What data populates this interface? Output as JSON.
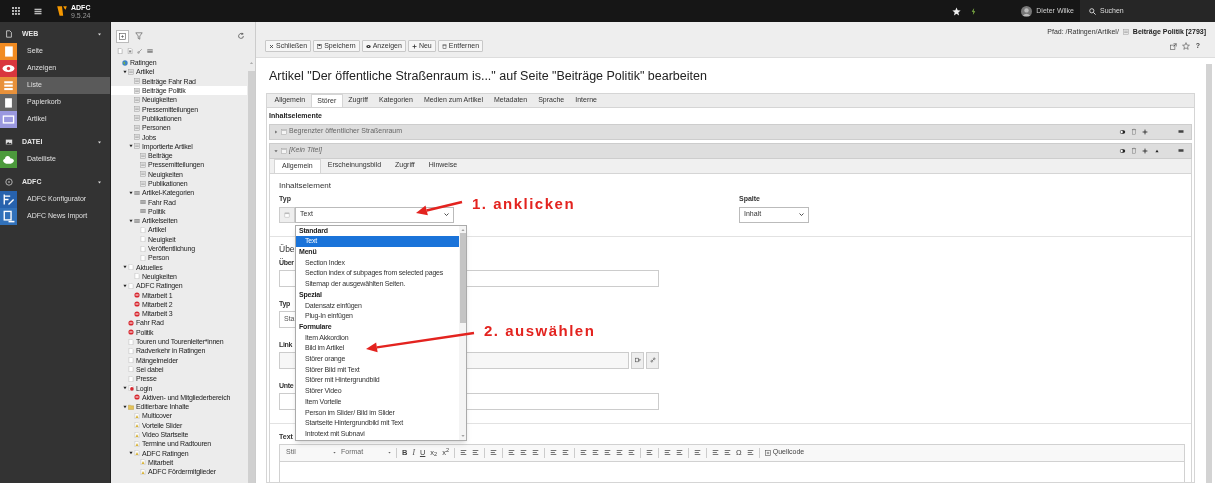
{
  "topbar": {
    "logo_title": "ADFC",
    "logo_version": "9.5.24",
    "user": "Dieter Wilke",
    "search": "Suchen"
  },
  "modules": [
    {
      "label": "WEB",
      "items": [
        {
          "label": "Seite",
          "color": "#f18b21",
          "selected": false
        },
        {
          "label": "Anzeigen",
          "color": "#d9363e",
          "selected": false
        },
        {
          "label": "Liste",
          "color": "#e8913a",
          "selected": true
        },
        {
          "label": "Papierkorb",
          "color": "#666666",
          "selected": false
        },
        {
          "label": "Artikel",
          "color": "#9a98df",
          "selected": false
        }
      ]
    },
    {
      "label": "DATEI",
      "items": [
        {
          "label": "Dateiliste",
          "color": "#4c9a3c",
          "selected": false
        }
      ]
    },
    {
      "label": "ADFC",
      "items": [
        {
          "label": "ADFC Konfigurator",
          "color": "#2762ad",
          "selected": false
        },
        {
          "label": "ADFC News Import",
          "color": "#3171ba",
          "selected": false
        }
      ]
    }
  ],
  "page_tree": {
    "nodes": [
      {
        "label": "Ratingen",
        "kind": "site",
        "selected": false,
        "children": [
          {
            "label": "Artikel",
            "kind": "folder",
            "selected": false,
            "expanded": true,
            "children": [
              {
                "label": "Beiträge Fahr Rad",
                "kind": "folder",
                "selected": false
              },
              {
                "label": "Beiträge Politik",
                "kind": "folder",
                "selected": true
              },
              {
                "label": "Neuigkeiten",
                "kind": "folder",
                "selected": false
              },
              {
                "label": "Pressemitteilungen",
                "kind": "folder",
                "selected": false
              },
              {
                "label": "Publikationen",
                "kind": "folder",
                "selected": false
              },
              {
                "label": "Personen",
                "kind": "folder",
                "selected": false
              },
              {
                "label": "Jobs",
                "kind": "folder",
                "selected": false
              },
              {
                "label": "Importierte Artikel",
                "kind": "folder",
                "selected": false,
                "expanded": true,
                "children": [
                  {
                    "label": "Beiträge",
                    "kind": "folder",
                    "selected": false
                  },
                  {
                    "label": "Pressemitteilungen",
                    "kind": "folder",
                    "selected": false
                  },
                  {
                    "label": "Neuigkeiten",
                    "kind": "folder",
                    "selected": false
                  },
                  {
                    "label": "Publikationen",
                    "kind": "folder",
                    "selected": false
                  }
                ]
              },
              {
                "label": "Artikel-Kategorien",
                "kind": "category",
                "selected": false,
                "expanded": true,
                "children": [
                  {
                    "label": "Fahr Rad",
                    "kind": "category",
                    "selected": false
                  },
                  {
                    "label": "Politik",
                    "kind": "category",
                    "selected": false
                  }
                ]
              },
              {
                "label": "Artikelseiten",
                "kind": "category",
                "selected": false,
                "expanded": true,
                "children": [
                  {
                    "label": "Artikel",
                    "kind": "page",
                    "selected": false
                  },
                  {
                    "label": "Neuigkeit",
                    "kind": "page",
                    "selected": false
                  },
                  {
                    "label": "Veröffentlichung",
                    "kind": "page",
                    "selected": false
                  },
                  {
                    "label": "Person",
                    "kind": "page",
                    "selected": false
                  }
                ]
              }
            ]
          },
          {
            "label": "Aktuelles",
            "kind": "page",
            "selected": false,
            "expanded": true,
            "children": [
              {
                "label": "Neuigkeiten",
                "kind": "page",
                "selected": false
              }
            ]
          },
          {
            "label": "ADFC Ratingen",
            "kind": "page",
            "selected": false,
            "expanded": true,
            "children": [
              {
                "label": "Mitarbeit 1",
                "kind": "restricted",
                "selected": false
              },
              {
                "label": "Mitarbeit 2",
                "kind": "restricted",
                "selected": false
              },
              {
                "label": "Mitarbeit 3",
                "kind": "restricted",
                "selected": false
              }
            ]
          },
          {
            "label": "Fahr Rad",
            "kind": "restricted",
            "selected": false
          },
          {
            "label": "Politik",
            "kind": "restricted",
            "selected": false
          },
          {
            "label": "Touren und Tourenleiter*innen",
            "kind": "page",
            "selected": false
          },
          {
            "label": "Radverkehr in Ratingen",
            "kind": "page",
            "selected": false
          },
          {
            "label": "Mängelmelder",
            "kind": "page",
            "selected": false
          },
          {
            "label": "Sei dabei",
            "kind": "page",
            "selected": false
          },
          {
            "label": "Presse",
            "kind": "page",
            "selected": false
          },
          {
            "label": "Login",
            "kind": "login",
            "selected": false,
            "expanded": true,
            "children": [
              {
                "label": "Aktiven- und Mitgliederbereich",
                "kind": "restricted",
                "selected": false
              }
            ]
          },
          {
            "label": "Editierbare Inhalte",
            "kind": "container",
            "selected": false,
            "expanded": true,
            "children": [
              {
                "label": "Multicover",
                "kind": "content",
                "selected": false
              },
              {
                "label": "Vorteile Slider",
                "kind": "content",
                "selected": false
              },
              {
                "label": "Video Startseite",
                "kind": "content",
                "selected": false
              },
              {
                "label": "Termine und Radtouren",
                "kind": "content",
                "selected": false
              },
              {
                "label": "ADFC Ratingen",
                "kind": "content",
                "selected": false,
                "expanded": true,
                "children": [
                  {
                    "label": "Mitarbeit",
                    "kind": "content",
                    "selected": false
                  },
                  {
                    "label": "ADFC Fördermitglieder",
                    "kind": "content",
                    "selected": false
                  }
                ]
              }
            ]
          }
        ]
      }
    ]
  },
  "doc_header": {
    "buttons": [
      {
        "label": "Schließen",
        "kind": "close"
      },
      {
        "label": "Speichern",
        "kind": "save"
      },
      {
        "label": "Anzeigen",
        "kind": "view"
      },
      {
        "label": "Neu",
        "kind": "new"
      },
      {
        "label": "Entfernen",
        "kind": "delete"
      }
    ],
    "path_prefix": "Pfad: /Ratingen/Artikel/",
    "path_page": "Beiträge Politik [2793]",
    "help": "?"
  },
  "title": "Artikel \"Der öffentliche Straßenraum is...\" auf Seite \"Beiträge Politik\" bearbeiten",
  "tabs": [
    {
      "label": "Allgemein",
      "selected": false
    },
    {
      "label": "Störer",
      "selected": true
    },
    {
      "label": "Zugriff",
      "selected": false
    },
    {
      "label": "Kategorien",
      "selected": false
    },
    {
      "label": "Medien zum Artikel",
      "selected": false
    },
    {
      "label": "Metadaten",
      "selected": false
    },
    {
      "label": "Sprache",
      "selected": false
    },
    {
      "label": "Interne",
      "selected": false
    }
  ],
  "section_label": "Inhaltselemente",
  "content_elements": [
    {
      "title": "Begrenzter öffentlicher Straßenraum",
      "untitled": false,
      "expanded": false,
      "can_move_up": false
    },
    {
      "title": "[Kein Titel]",
      "untitled": true,
      "expanded": true,
      "can_move_up": true
    }
  ],
  "element_form": {
    "tabs": [
      {
        "label": "Allgemein",
        "selected": true
      },
      {
        "label": "Erscheinungsbild",
        "selected": false
      },
      {
        "label": "Zugriff",
        "selected": false
      },
      {
        "label": "Hinweise",
        "selected": false
      }
    ],
    "heading": "Inhaltselement",
    "type_label": "Typ",
    "type_value": "Text",
    "column_label": "Spalte",
    "column_value": "Inhalt",
    "dropdown": [
      {
        "label": "Standard",
        "options": [
          {
            "label": "Text",
            "selected": true
          }
        ]
      },
      {
        "label": "Menü",
        "options": [
          {
            "label": "Section Index",
            "selected": false
          },
          {
            "label": "Section index of subpages from selected pages",
            "selected": false
          },
          {
            "label": "Sitemap der ausgewählten Seiten.",
            "selected": false
          }
        ]
      },
      {
        "label": "Spezial",
        "options": [
          {
            "label": "Datensatz einfügen",
            "selected": false
          },
          {
            "label": "Plug-In einfügen",
            "selected": false
          }
        ]
      },
      {
        "label": "Formulare",
        "options": [
          {
            "label": "Item Akkordion",
            "selected": false
          },
          {
            "label": "Bild im Artikel",
            "selected": false
          },
          {
            "label": "Störer orange",
            "selected": false
          },
          {
            "label": "Störer Bild mit Text",
            "selected": false
          },
          {
            "label": "Störer mit Hintergrundbild",
            "selected": false
          },
          {
            "label": "Störer Video",
            "selected": false
          },
          {
            "label": "Item Vorteile",
            "selected": false
          },
          {
            "label": "Person im Slider/ Bild im Slider",
            "selected": false
          },
          {
            "label": "Startseite Hintergrundbild mit Text",
            "selected": false
          },
          {
            "label": "Introtext mit Subnavi",
            "selected": false
          }
        ]
      }
    ],
    "covered_fields": [
      {
        "kind": "heading",
        "label": "Übe"
      },
      {
        "kind": "input",
        "label": "Über"
      },
      {
        "kind": "select",
        "label": "Typ",
        "value": "Sta"
      },
      {
        "kind": "link",
        "label": "Link"
      },
      {
        "kind": "input",
        "label": "Unte"
      }
    ],
    "text_label": "Text",
    "editor_toolbar": [
      {
        "kind": "dropdown",
        "label": "Stil"
      },
      {
        "kind": "dropdown",
        "label": "Format"
      },
      {
        "kind": "sep"
      },
      {
        "kind": "bold",
        "label": "B"
      },
      {
        "kind": "italic",
        "label": "I"
      },
      {
        "kind": "underline",
        "label": "U"
      },
      {
        "kind": "char",
        "label": "x$_{2}$"
      },
      {
        "kind": "char",
        "label": "x$^{2}$"
      },
      {
        "kind": "sep"
      },
      {
        "kind": "icon"
      },
      {
        "kind": "icon"
      },
      {
        "kind": "sep"
      },
      {
        "kind": "icon"
      },
      {
        "kind": "sep"
      },
      {
        "kind": "icon"
      },
      {
        "kind": "icon"
      },
      {
        "kind": "icon"
      },
      {
        "kind": "sep"
      },
      {
        "kind": "icon"
      },
      {
        "kind": "icon"
      },
      {
        "kind": "sep"
      },
      {
        "kind": "icon"
      },
      {
        "kind": "icon"
      },
      {
        "kind": "icon"
      },
      {
        "kind": "icon"
      },
      {
        "kind": "icon"
      },
      {
        "kind": "sep"
      },
      {
        "kind": "icon"
      },
      {
        "kind": "sep"
      },
      {
        "kind": "icon"
      },
      {
        "kind": "icon"
      },
      {
        "kind": "sep"
      },
      {
        "kind": "icon"
      },
      {
        "kind": "sep"
      },
      {
        "kind": "icon"
      },
      {
        "kind": "icon"
      },
      {
        "kind": "char",
        "label": "Ω"
      },
      {
        "kind": "icon"
      },
      {
        "kind": "sep"
      },
      {
        "kind": "source",
        "label": "Quellcode"
      }
    ]
  },
  "annotations": [
    {
      "text": "1. anklicken"
    },
    {
      "text": "2. auswählen"
    }
  ]
}
